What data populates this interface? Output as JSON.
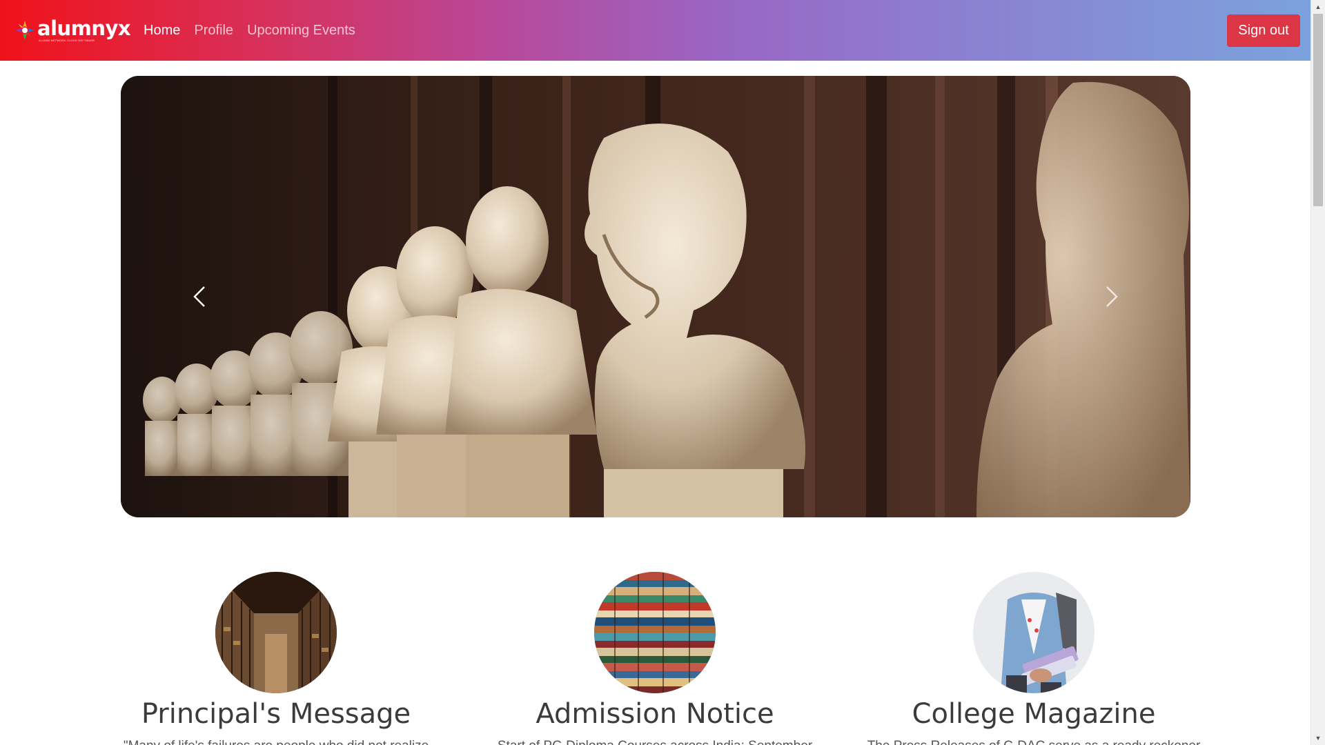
{
  "navbar": {
    "brand_name": "alumnyx",
    "brand_tagline": "ALUMNI NETWORK CLOUD SOFTWARE",
    "links": [
      {
        "label": "Home",
        "active": true
      },
      {
        "label": "Profile",
        "active": false
      },
      {
        "label": "Upcoming Events",
        "active": false
      }
    ],
    "signout_label": "Sign out"
  },
  "colors": {
    "navbar_gradient_start": "#f0121a",
    "navbar_gradient_mid": "#9966c4",
    "navbar_gradient_end": "#7ba2dc",
    "signout_button": "#dc3545",
    "heading_text": "#3b3b3b"
  },
  "carousel": {
    "image": "row of marble busts in a library",
    "prev_icon": "chevron-left-icon",
    "next_icon": "chevron-right-icon"
  },
  "features": [
    {
      "title": "Principal's Message",
      "text": "\"Many of life's failures are people who did not realize",
      "image": "library corridor"
    },
    {
      "title": "Admission Notice",
      "text": "Start of PG Diploma Courses across India: September",
      "image": "stacked books"
    },
    {
      "title": "College Magazine",
      "text": "The Press Releases of C-DAC serve as a ready reckoner",
      "image": "student holding books"
    }
  ]
}
